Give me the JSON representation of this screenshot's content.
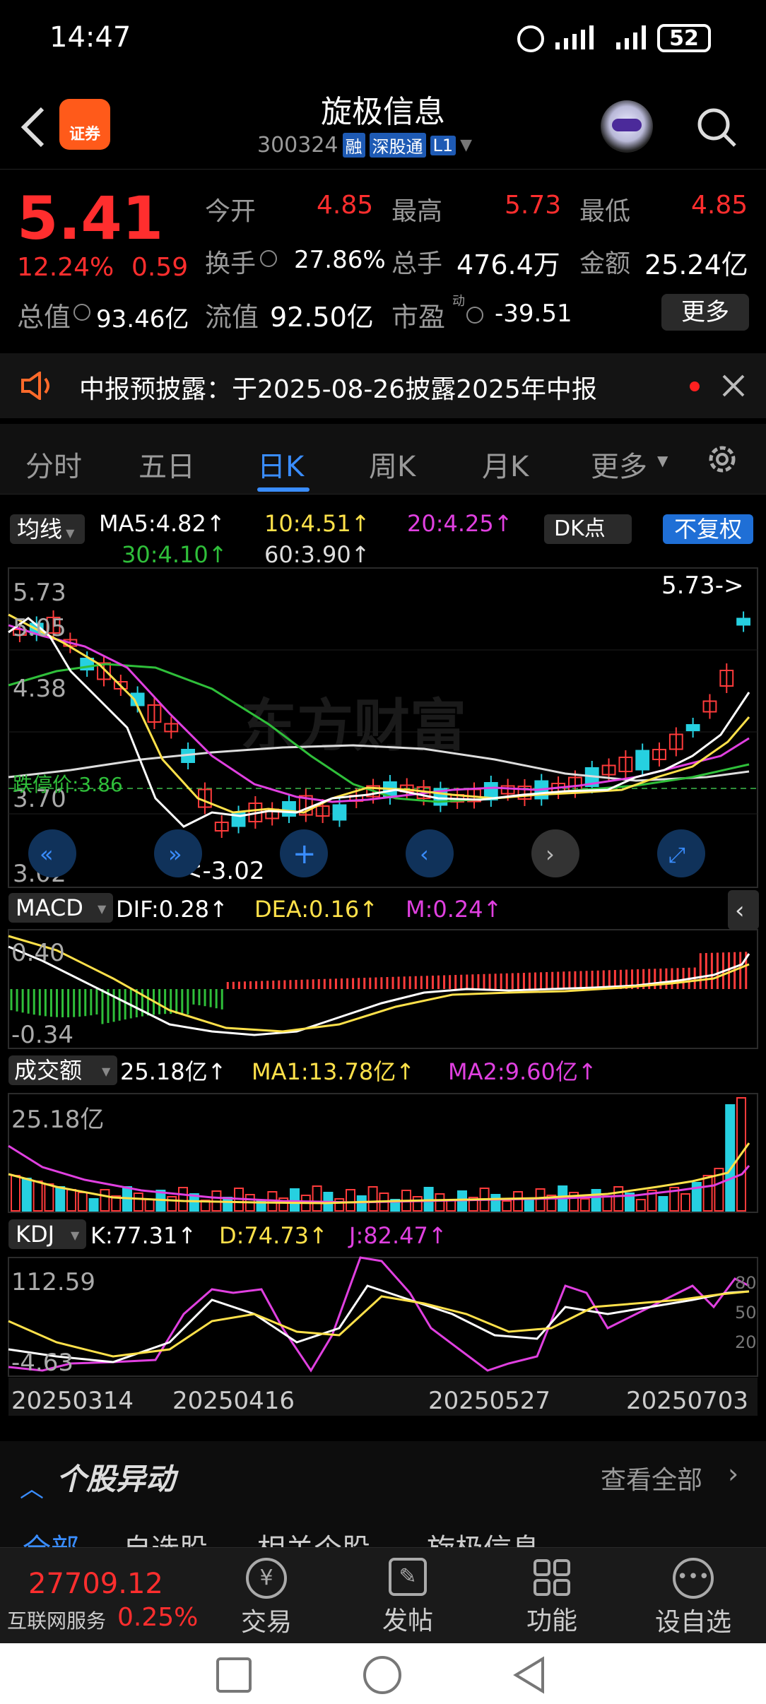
{
  "status": {
    "time": "14:47",
    "battery": "52"
  },
  "header": {
    "title": "旋极信息",
    "code": "300324",
    "badge_logo": "证券",
    "tags": [
      "融",
      "深股通",
      "L1"
    ]
  },
  "quote": {
    "price": "5.41",
    "pct": "12.24%",
    "chg": "0.59",
    "row1": [
      {
        "label": "今开",
        "value": "4.85"
      },
      {
        "label": "最高",
        "value": "5.73"
      },
      {
        "label": "最低",
        "value": "4.85"
      }
    ],
    "row2": [
      {
        "label": "换手",
        "value": "27.86%"
      },
      {
        "label": "总手",
        "value": "476.4万"
      },
      {
        "label": "金额",
        "value": "25.24亿"
      }
    ],
    "total_label": "总值",
    "total_value": "93.46亿",
    "float_label": "流值",
    "float_value": "92.50亿",
    "pe_label": "市盈",
    "pe_sup": "动",
    "pe_value": "-39.51",
    "more_label": "更多"
  },
  "notice": {
    "text": "中报预披露：于2025-08-26披露2025年中报"
  },
  "tabs": [
    "分时",
    "五日",
    "日K",
    "周K",
    "月K",
    "更多"
  ],
  "active_tab": "日K",
  "ma": {
    "label": "均线",
    "ma5": "MA5:4.82↑",
    "ma10": "10:4.51↑",
    "ma20": "20:4.25↑",
    "ma30": "30:4.10↑",
    "ma60": "60:3.90↑",
    "dk": "DK点",
    "fq": "不复权"
  },
  "kchart": {
    "high": "5.73",
    "low": "3.02",
    "mid1": "5.05",
    "mid2": "4.38",
    "mid3": "3.70",
    "high_mark": "5.73->",
    "low_mark": "<-3.02",
    "limit_down": "跌停价:3.86",
    "watermark": "东方财富"
  },
  "macd": {
    "label": "MACD",
    "dif": "DIF:0.28↑",
    "dea": "DEA:0.16↑",
    "m": "M:0.24↑",
    "top": "0.40",
    "bottom": "-0.34"
  },
  "volume": {
    "label": "成交额",
    "val": "25.18亿↑",
    "ma1": "MA1:13.78亿↑",
    "ma2": "MA2:9.60亿↑",
    "top": "25.18亿"
  },
  "kdj": {
    "label": "KDJ",
    "k": "K:77.31↑",
    "d": "D:74.73↑",
    "j": "J:82.47↑",
    "top": "112.59",
    "bottom": "-4.63",
    "lv80": "80",
    "lv50": "50",
    "lv20": "20"
  },
  "dates": [
    "20250314",
    "20250416",
    "20250527",
    "20250703"
  ],
  "section": {
    "title": "个股异动",
    "more": "查看全部",
    "subtabs": [
      "全部",
      "自选股",
      "相关个股",
      "旋极信息"
    ]
  },
  "bottom": {
    "index": "27709.12",
    "index_name": "互联网服务",
    "index_pct": "0.25%",
    "nav": [
      "交易",
      "发帖",
      "功能",
      "设自选"
    ]
  }
}
